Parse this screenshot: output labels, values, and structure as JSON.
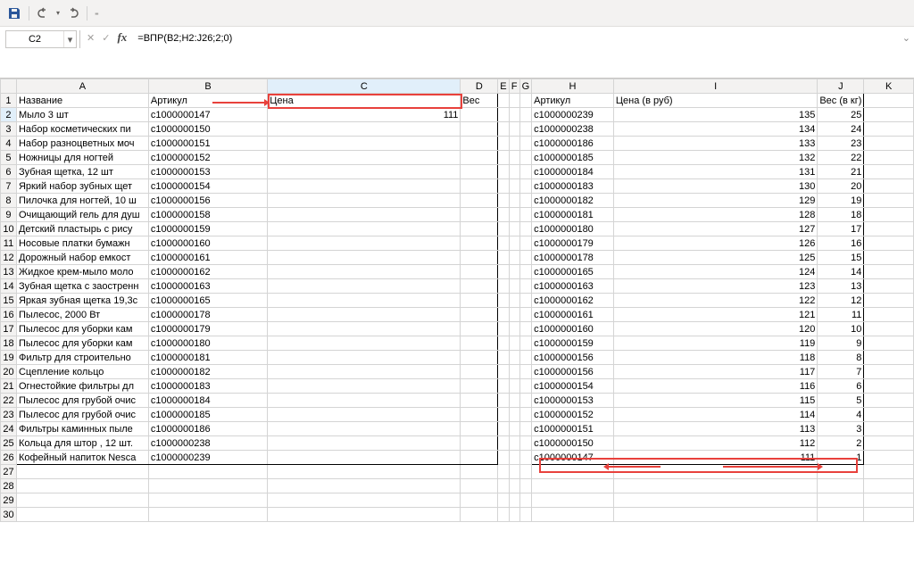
{
  "qat": {
    "dropdown_hint": "▾"
  },
  "namebox": {
    "value": "C2"
  },
  "formula": {
    "value": "=ВПР(B2;H2:J26;2;0)"
  },
  "cols": [
    "A",
    "B",
    "C",
    "D",
    "E",
    "F",
    "G",
    "H",
    "I",
    "J",
    "K"
  ],
  "headers_left": {
    "A": "Название",
    "B": "Артикул",
    "C": "Цена",
    "D": "Вес"
  },
  "headers_right": {
    "H": "Артикул",
    "I": "Цена (в руб)",
    "J": "Вес (в кг)"
  },
  "left_rows": [
    {
      "name": "Мыло 3 шт",
      "art": "с1000000147",
      "price": "111"
    },
    {
      "name": "Набор косметических пи",
      "art": "с1000000150"
    },
    {
      "name": "Набор разноцветных моч",
      "art": "с1000000151"
    },
    {
      "name": "Ножницы для ногтей",
      "art": "с1000000152"
    },
    {
      "name": "Зубная щетка, 12 шт",
      "art": "с1000000153"
    },
    {
      "name": "Яркий набор зубных щет",
      "art": "с1000000154"
    },
    {
      "name": "Пилочка для ногтей, 10 ш",
      "art": "с1000000156"
    },
    {
      "name": "Очищающий гель для душ",
      "art": "с1000000158"
    },
    {
      "name": "Детский пластырь с рису",
      "art": "с1000000159"
    },
    {
      "name": "Носовые платки бумажн",
      "art": "с1000000160"
    },
    {
      "name": "Дорожный набор емкост",
      "art": "с1000000161"
    },
    {
      "name": "Жидкое крем-мыло моло",
      "art": "с1000000162"
    },
    {
      "name": "Зубная щетка с заостренн",
      "art": "с1000000163"
    },
    {
      "name": "Яркая зубная щетка 19,3с",
      "art": "с1000000165"
    },
    {
      "name": "Пылесос, 2000 Вт",
      "art": "с1000000178"
    },
    {
      "name": "Пылесос для уборки кам",
      "art": "с1000000179"
    },
    {
      "name": "Пылесос для уборки кам",
      "art": "с1000000180"
    },
    {
      "name": "Фильтр для строительно",
      "art": "с1000000181"
    },
    {
      "name": "Сцепление кольцо",
      "art": "с1000000182"
    },
    {
      "name": "Огнестойкие фильтры дл",
      "art": "с1000000183"
    },
    {
      "name": "Пылесос для грубой очис",
      "art": "с1000000184"
    },
    {
      "name": "Пылесос для грубой очис",
      "art": "с1000000185"
    },
    {
      "name": "Фильтры каминных пыле",
      "art": "с1000000186"
    },
    {
      "name": "Кольца для штор , 12 шт.",
      "art": "с1000000238"
    },
    {
      "name": "Кофейный напиток Nesca",
      "art": "с1000000239"
    }
  ],
  "right_rows": [
    {
      "art": "с1000000239",
      "price": "135",
      "weight": "25"
    },
    {
      "art": "с1000000238",
      "price": "134",
      "weight": "24"
    },
    {
      "art": "с1000000186",
      "price": "133",
      "weight": "23"
    },
    {
      "art": "с1000000185",
      "price": "132",
      "weight": "22"
    },
    {
      "art": "с1000000184",
      "price": "131",
      "weight": "21"
    },
    {
      "art": "с1000000183",
      "price": "130",
      "weight": "20"
    },
    {
      "art": "с1000000182",
      "price": "129",
      "weight": "19"
    },
    {
      "art": "с1000000181",
      "price": "128",
      "weight": "18"
    },
    {
      "art": "с1000000180",
      "price": "127",
      "weight": "17"
    },
    {
      "art": "с1000000179",
      "price": "126",
      "weight": "16"
    },
    {
      "art": "с1000000178",
      "price": "125",
      "weight": "15"
    },
    {
      "art": "с1000000165",
      "price": "124",
      "weight": "14"
    },
    {
      "art": "с1000000163",
      "price": "123",
      "weight": "13"
    },
    {
      "art": "с1000000162",
      "price": "122",
      "weight": "12"
    },
    {
      "art": "с1000000161",
      "price": "121",
      "weight": "11"
    },
    {
      "art": "с1000000160",
      "price": "120",
      "weight": "10"
    },
    {
      "art": "с1000000159",
      "price": "119",
      "weight": "9"
    },
    {
      "art": "с1000000156",
      "price": "118",
      "weight": "8"
    },
    {
      "art": "с1000000156",
      "price": "117",
      "weight": "7"
    },
    {
      "art": "с1000000154",
      "price": "116",
      "weight": "6"
    },
    {
      "art": "с1000000153",
      "price": "115",
      "weight": "5"
    },
    {
      "art": "с1000000152",
      "price": "114",
      "weight": "4"
    },
    {
      "art": "с1000000151",
      "price": "113",
      "weight": "3"
    },
    {
      "art": "с1000000150",
      "price": "112",
      "weight": "2"
    },
    {
      "art": "с1000000147",
      "price": "111",
      "weight": "1"
    }
  ],
  "empty_rows": [
    "27",
    "28",
    "29",
    "30"
  ]
}
